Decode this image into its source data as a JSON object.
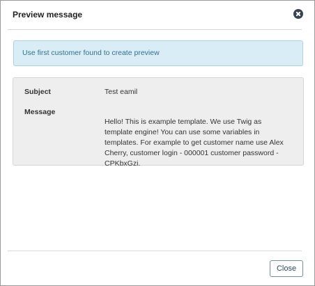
{
  "dialog": {
    "title": "Preview message",
    "close_icon": "close-circle-icon"
  },
  "info": {
    "text": "Use first customer found to create preview",
    "color": "#d9edf7"
  },
  "preview": {
    "subject_label": "Subject",
    "subject_value": "Test eamil",
    "message_label": "Message",
    "message_value": "Hello! This is example template. We use Twig as template engine! You can use some variables in templates. For example to get customer name use Alex Cherry, customer login - 000001 customer password - CPKbxGzi."
  },
  "footer": {
    "close_label": "Close"
  }
}
